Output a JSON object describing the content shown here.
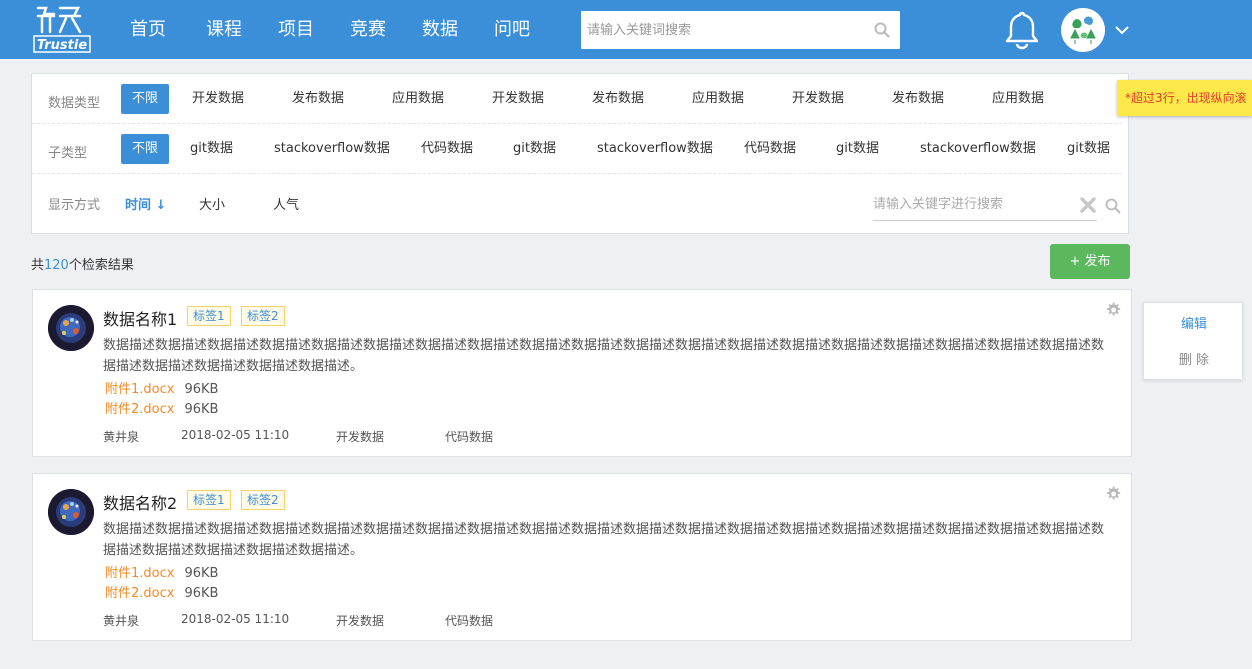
{
  "header": {
    "logo_text": "Trustie",
    "nav": [
      "首页",
      "课程",
      "项目",
      "竞赛",
      "数据",
      "问吧"
    ],
    "search_placeholder": "请输入关键词搜索"
  },
  "filters": {
    "type_label": "数据类型",
    "type_options": [
      "不限",
      "开发数据",
      "发布数据",
      "应用数据",
      "开发数据",
      "发布数据",
      "应用数据",
      "开发数据",
      "发布数据",
      "应用数据"
    ],
    "subtype_label": "子类型",
    "subtype_options": [
      "不限",
      "git数据",
      "stackoverflow数据",
      "代码数据",
      "git数据",
      "stackoverflow数据",
      "代码数据",
      "git数据",
      "stackoverflow数据",
      "git数据"
    ],
    "display_label": "显示方式",
    "sort_options": [
      "时间 ↓",
      "大小",
      "人气"
    ],
    "search_placeholder": "请输入关键字进行搜索"
  },
  "note": "*超过3行，出现纵向滚",
  "results": {
    "prefix": "共",
    "count": "120",
    "suffix": "个检索结果",
    "publish_label": "+ 发布"
  },
  "cards": [
    {
      "title": "数据名称1",
      "tags": [
        "标签1",
        "标签2"
      ],
      "desc": "数据描述数据描述数据描述数据描述数据描述数据描述数据描述数据描述数据描述数据描述数据描述数据描述数据描述数据描述数据描述数据描述数据描述数据描述数据描述数据描述数据描述数据描述数据描述数据描述。",
      "attachments": [
        {
          "name": "附件1.docx",
          "size": "96KB"
        },
        {
          "name": "附件2.docx",
          "size": "96KB"
        }
      ],
      "author": "黄井泉",
      "time": "2018-02-05 11:10",
      "type": "开发数据",
      "subtype": "代码数据"
    },
    {
      "title": "数据名称2",
      "tags": [
        "标签1",
        "标签2"
      ],
      "desc": "数据描述数据描述数据描述数据描述数据描述数据描述数据描述数据描述数据描述数据描述数据描述数据描述数据描述数据描述数据描述数据描述数据描述数据描述数据描述数据描述数据描述数据描述数据描述数据描述。",
      "attachments": [
        {
          "name": "附件1.docx",
          "size": "96KB"
        },
        {
          "name": "附件2.docx",
          "size": "96KB"
        }
      ],
      "author": "黄井泉",
      "time": "2018-02-05 11:10",
      "type": "开发数据",
      "subtype": "代码数据"
    }
  ],
  "context_menu": {
    "edit": "编辑",
    "delete": "删 除"
  },
  "colors": {
    "primary": "#3b8fd9",
    "accent_orange": "#f08c28",
    "publish_green": "#5cb85c",
    "note_yellow": "#ffe94a"
  }
}
